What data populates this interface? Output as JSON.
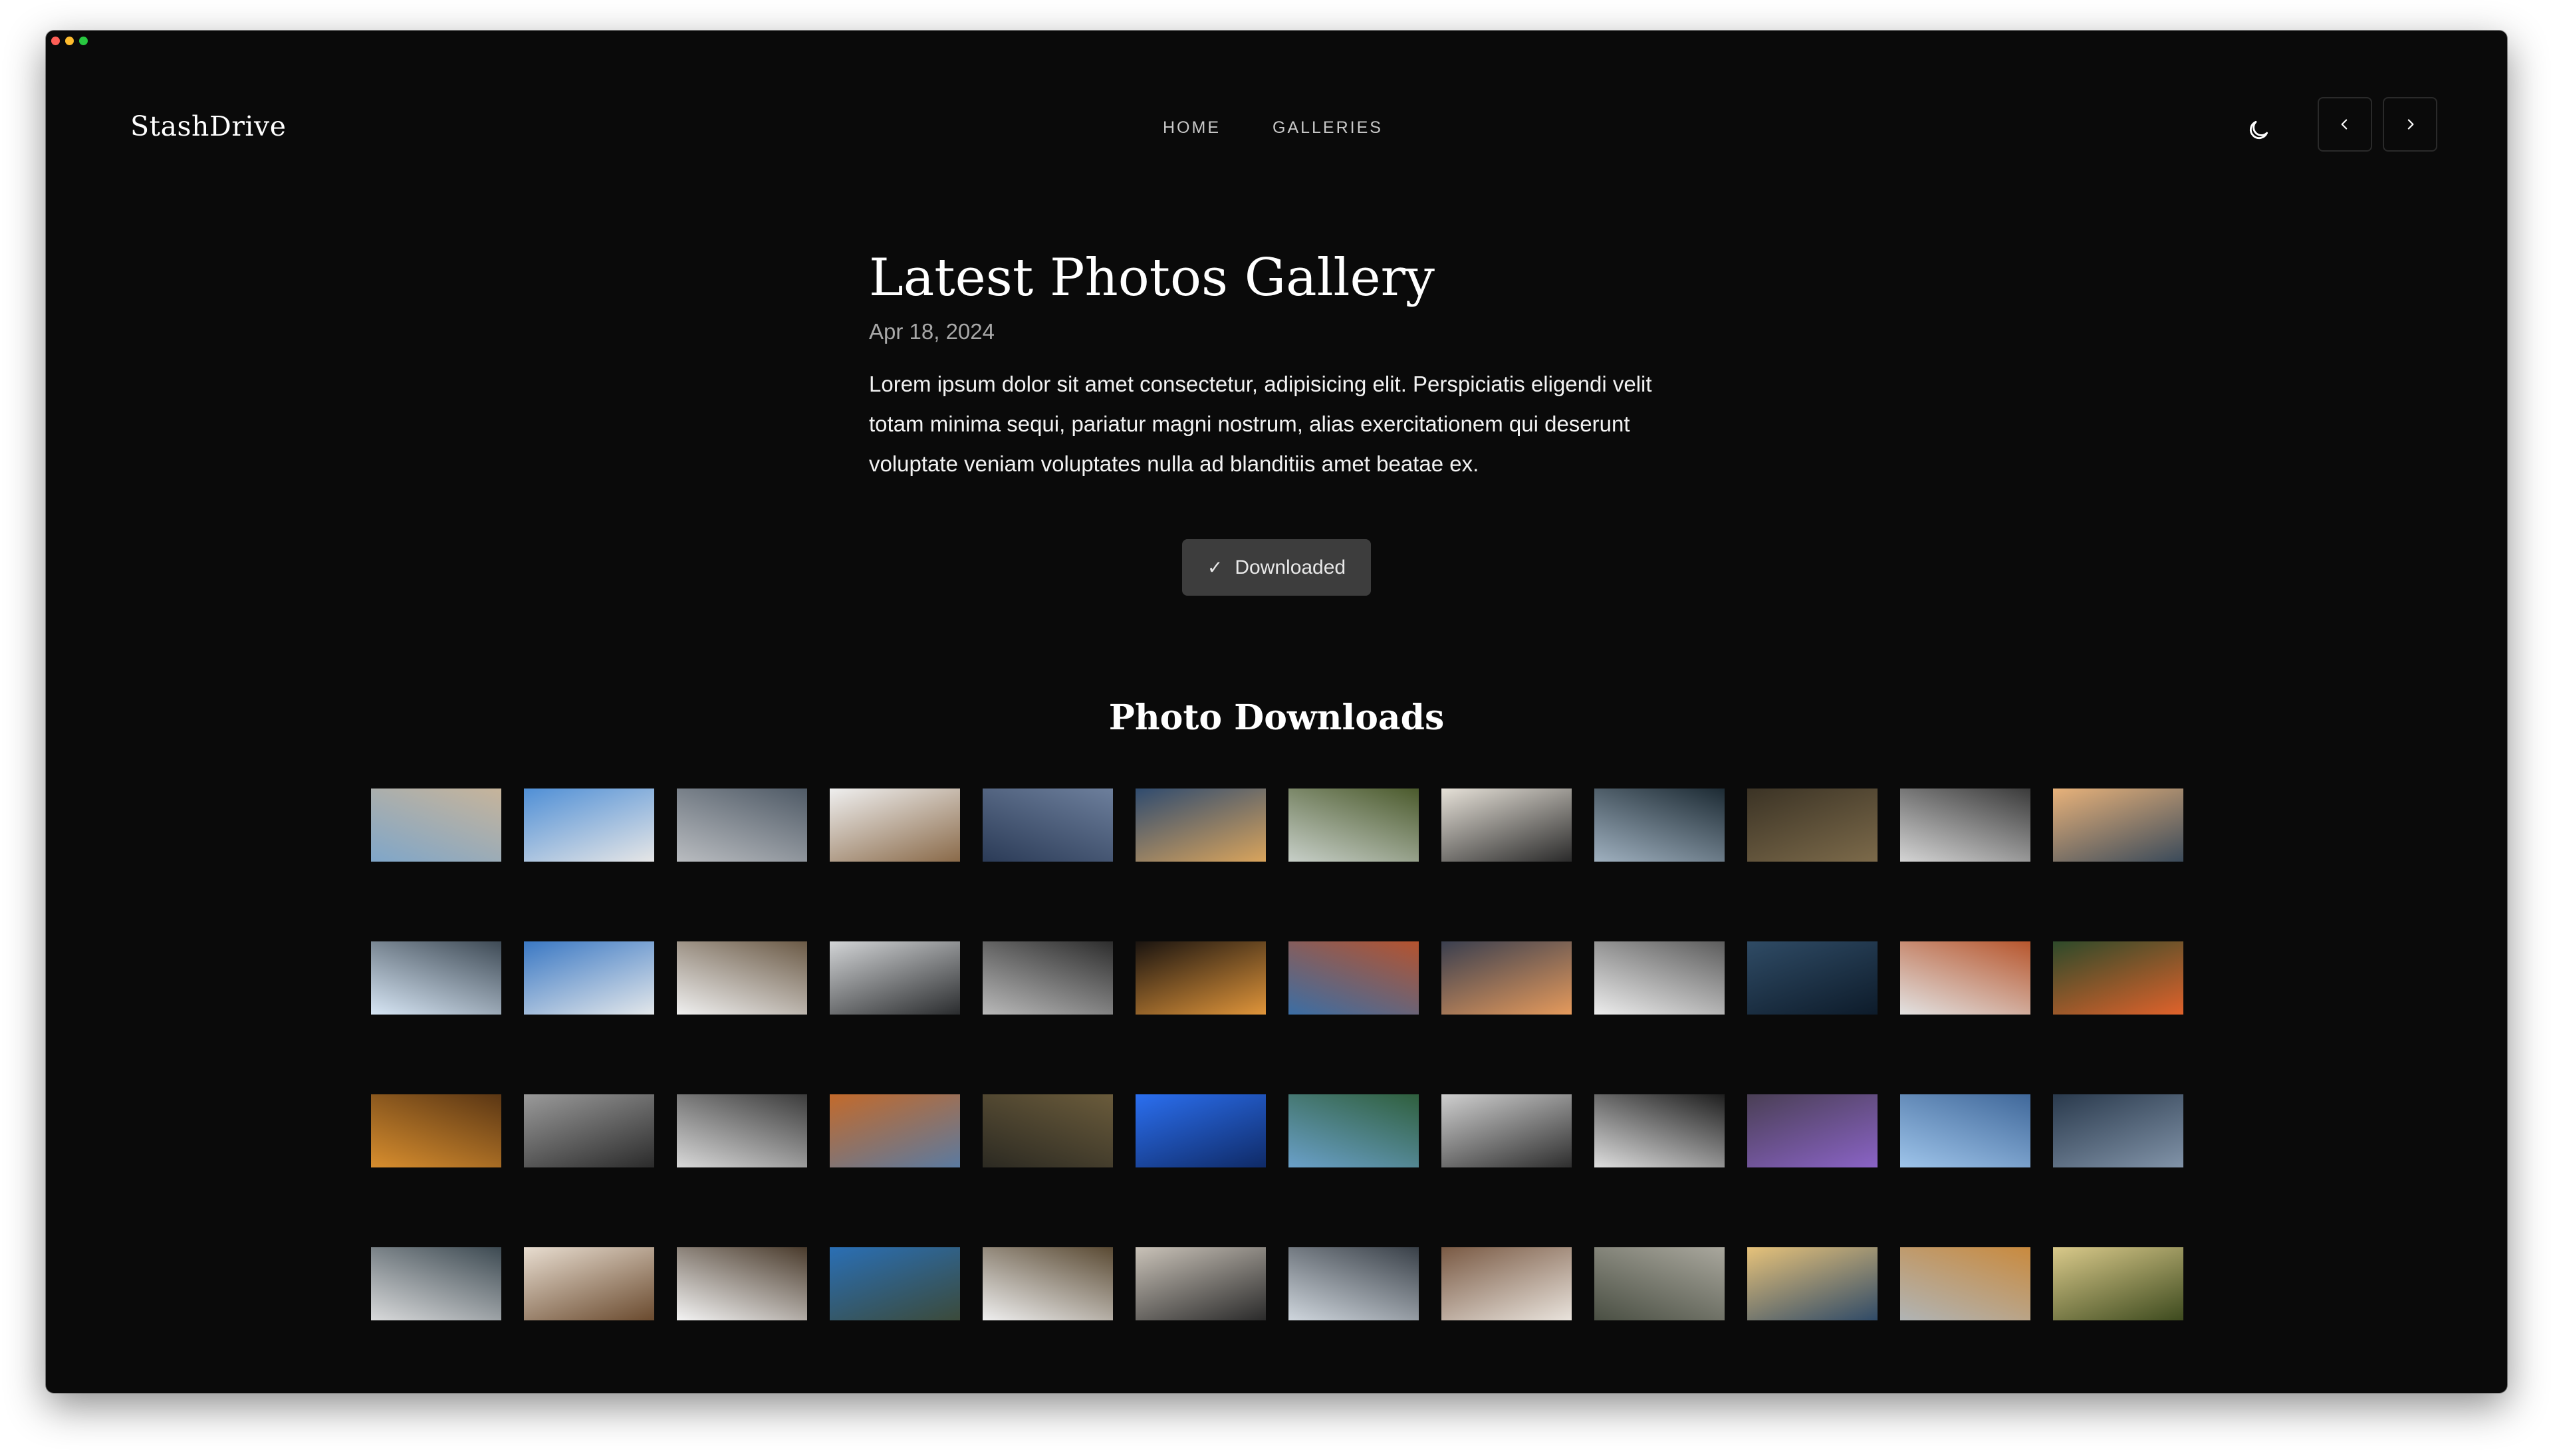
{
  "brand": "StashDrive",
  "nav": [
    {
      "label": "HOME"
    },
    {
      "label": "GALLERIES"
    }
  ],
  "controls": {
    "theme_icon": "moon-icon",
    "prev_icon": "chevron-left-icon",
    "next_icon": "chevron-right-icon"
  },
  "page": {
    "title": "Latest Photos Gallery",
    "date": "Apr 18, 2024",
    "description": "Lorem ipsum dolor sit amet consectetur, adipisicing elit. Perspiciatis eligendi velit totam minima sequi, pariatur magni nostrum, alias exercitationem qui deserunt voluptate veniam voluptates nulla ad blanditiis amet beatae ex.",
    "download_label": "Downloaded",
    "download_icon": "check-icon"
  },
  "downloads": {
    "title": "Photo Downloads",
    "photos": [
      {
        "a": "#7fa6c9",
        "b": "#c7b49a"
      },
      {
        "a": "#4f8fd6",
        "b": "#e6e6e6"
      },
      {
        "a": "#b9bcc0",
        "b": "#4f5a66"
      },
      {
        "a": "#efefef",
        "b": "#8a6a49"
      },
      {
        "a": "#2b3b57",
        "b": "#6d7f9c"
      },
      {
        "a": "#2f4b6f",
        "b": "#d9a45c"
      },
      {
        "a": "#c7cfc8",
        "b": "#4b5a2c"
      },
      {
        "a": "#e6e1d8",
        "b": "#2a2a2a"
      },
      {
        "a": "#9fb0bf",
        "b": "#1c2a33"
      },
      {
        "a": "#3b3325",
        "b": "#7c6a4a"
      },
      {
        "a": "#d4d4d4",
        "b": "#3a3a3a"
      },
      {
        "a": "#e8b27a",
        "b": "#3a4a5a"
      },
      {
        "a": "#d7e6f5",
        "b": "#3e4a55"
      },
      {
        "a": "#3a78c4",
        "b": "#e3e7ea"
      },
      {
        "a": "#f0f0f0",
        "b": "#6b5a46"
      },
      {
        "a": "#d2d4d6",
        "b": "#2a2c2e"
      },
      {
        "a": "#b9b9b9",
        "b": "#2d2d2d"
      },
      {
        "a": "#1a1410",
        "b": "#e0953a"
      },
      {
        "a": "#3b6ea5",
        "b": "#b5532e"
      },
      {
        "a": "#3a3f4f",
        "b": "#e59a5c"
      },
      {
        "a": "#ededed",
        "b": "#5c5c5c"
      },
      {
        "a": "#2f4b65",
        "b": "#0d1b2a"
      },
      {
        "a": "#e2e2e2",
        "b": "#b7562d"
      },
      {
        "a": "#2d4a2a",
        "b": "#e0622b"
      },
      {
        "a": "#d88e2e",
        "b": "#5a3614"
      },
      {
        "a": "#9a9a9a",
        "b": "#2b2b2b"
      },
      {
        "a": "#d8d8d8",
        "b": "#3c3c3c"
      },
      {
        "a": "#c36a2b",
        "b": "#5b7aa0"
      },
      {
        "a": "#2c2a22",
        "b": "#6a5b3b"
      },
      {
        "a": "#2b6ff0",
        "b": "#0f2a66"
      },
      {
        "a": "#6aa0c9",
        "b": "#2f5f3d"
      },
      {
        "a": "#cfcfcf",
        "b": "#2e2e2e"
      },
      {
        "a": "#dedede",
        "b": "#1e1e1e"
      },
      {
        "a": "#4a3f55",
        "b": "#8a63c6"
      },
      {
        "a": "#9ec4ea",
        "b": "#40689a"
      },
      {
        "a": "#2a3a4d",
        "b": "#8193a8"
      },
      {
        "a": "#d9dadb",
        "b": "#3d4a52"
      },
      {
        "a": "#e8ddd0",
        "b": "#6a4a2e"
      },
      {
        "a": "#f4f4f4",
        "b": "#4a3b2c"
      },
      {
        "a": "#2a6fb5",
        "b": "#3b4a3a"
      },
      {
        "a": "#efefef",
        "b": "#5a4a33"
      },
      {
        "a": "#c9c2b8",
        "b": "#2a2a2a"
      },
      {
        "a": "#cfd6dd",
        "b": "#394048"
      },
      {
        "a": "#7a5a44",
        "b": "#e9e3dc"
      },
      {
        "a": "#4a4f43",
        "b": "#a9a79d"
      },
      {
        "a": "#e6c27a",
        "b": "#2f4a67"
      },
      {
        "a": "#b0b4b5",
        "b": "#c98a3e"
      },
      {
        "a": "#d9c98a",
        "b": "#3d4a1e"
      }
    ]
  }
}
